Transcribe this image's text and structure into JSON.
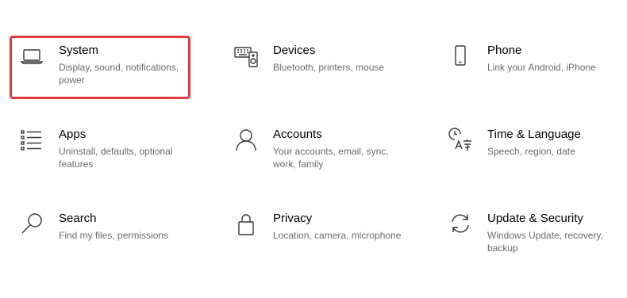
{
  "settings_tiles": [
    {
      "name": "system",
      "title": "System",
      "description": "Display, sound, notifications, power",
      "icon": "laptop-icon"
    },
    {
      "name": "devices",
      "title": "Devices",
      "description": "Bluetooth, printers, mouse",
      "icon": "keyboard-speaker-icon"
    },
    {
      "name": "phone",
      "title": "Phone",
      "description": "Link your Android, iPhone",
      "icon": "phone-icon"
    },
    {
      "name": "apps",
      "title": "Apps",
      "description": "Uninstall, defaults, optional features",
      "icon": "apps-list-icon"
    },
    {
      "name": "accounts",
      "title": "Accounts",
      "description": "Your accounts, email, sync, work, family",
      "icon": "person-icon"
    },
    {
      "name": "time-language",
      "title": "Time & Language",
      "description": "Speech, region, date",
      "icon": "clock-language-icon"
    },
    {
      "name": "search",
      "title": "Search",
      "description": "Find my files, permissions",
      "icon": "magnifier-icon"
    },
    {
      "name": "privacy",
      "title": "Privacy",
      "description": "Location, camera, microphone",
      "icon": "lock-icon"
    },
    {
      "name": "update-security",
      "title": "Update & Security",
      "description": "Windows Update, recovery, backup",
      "icon": "sync-arrows-icon"
    }
  ],
  "highlight": {
    "target": "system",
    "color": "#e0393e"
  },
  "colors": {
    "title": "#000000",
    "description": "#6b6b6b",
    "icon": "#3a3a3a"
  }
}
